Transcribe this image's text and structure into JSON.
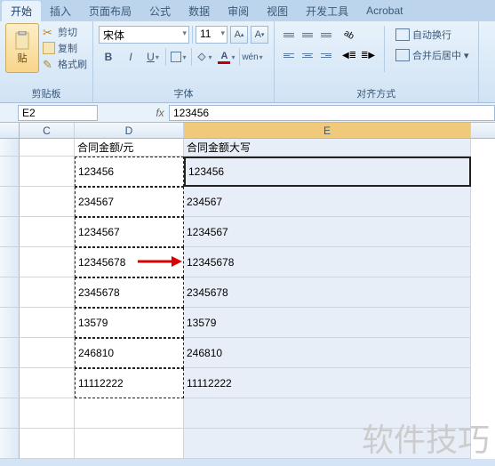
{
  "tabs": [
    "开始",
    "插入",
    "页面布局",
    "公式",
    "数据",
    "审阅",
    "视图",
    "开发工具",
    "Acrobat"
  ],
  "active_tab": 0,
  "clipboard": {
    "paste": "贴",
    "cut": "剪切",
    "copy": "复制",
    "format_painter": "格式刷",
    "group_label": "剪贴板"
  },
  "font": {
    "name": "宋体",
    "size": "11",
    "group_label": "字体"
  },
  "alignment": {
    "wrap": "自动换行",
    "merge": "合并后居中",
    "group_label": "对齐方式"
  },
  "namebox": "E2",
  "fx": "fx",
  "formula": "123456",
  "columns": [
    "C",
    "D",
    "E"
  ],
  "header_row": {
    "d": "合同金额/元",
    "e": "合同金额大写"
  },
  "rows": [
    {
      "d": "123456",
      "e": "123456"
    },
    {
      "d": "234567",
      "e": "234567"
    },
    {
      "d": "1234567",
      "e": "1234567"
    },
    {
      "d": "12345678",
      "e": "12345678"
    },
    {
      "d": "2345678",
      "e": "2345678"
    },
    {
      "d": "13579",
      "e": "13579"
    },
    {
      "d": "246810",
      "e": "246810"
    },
    {
      "d": "11112222",
      "e": "11112222"
    }
  ],
  "watermark": "软件技巧",
  "colors": {
    "accent": "#f0c97b",
    "grid": "#d4d4d4",
    "fill": "#fff000",
    "font_color": "#c00000"
  }
}
